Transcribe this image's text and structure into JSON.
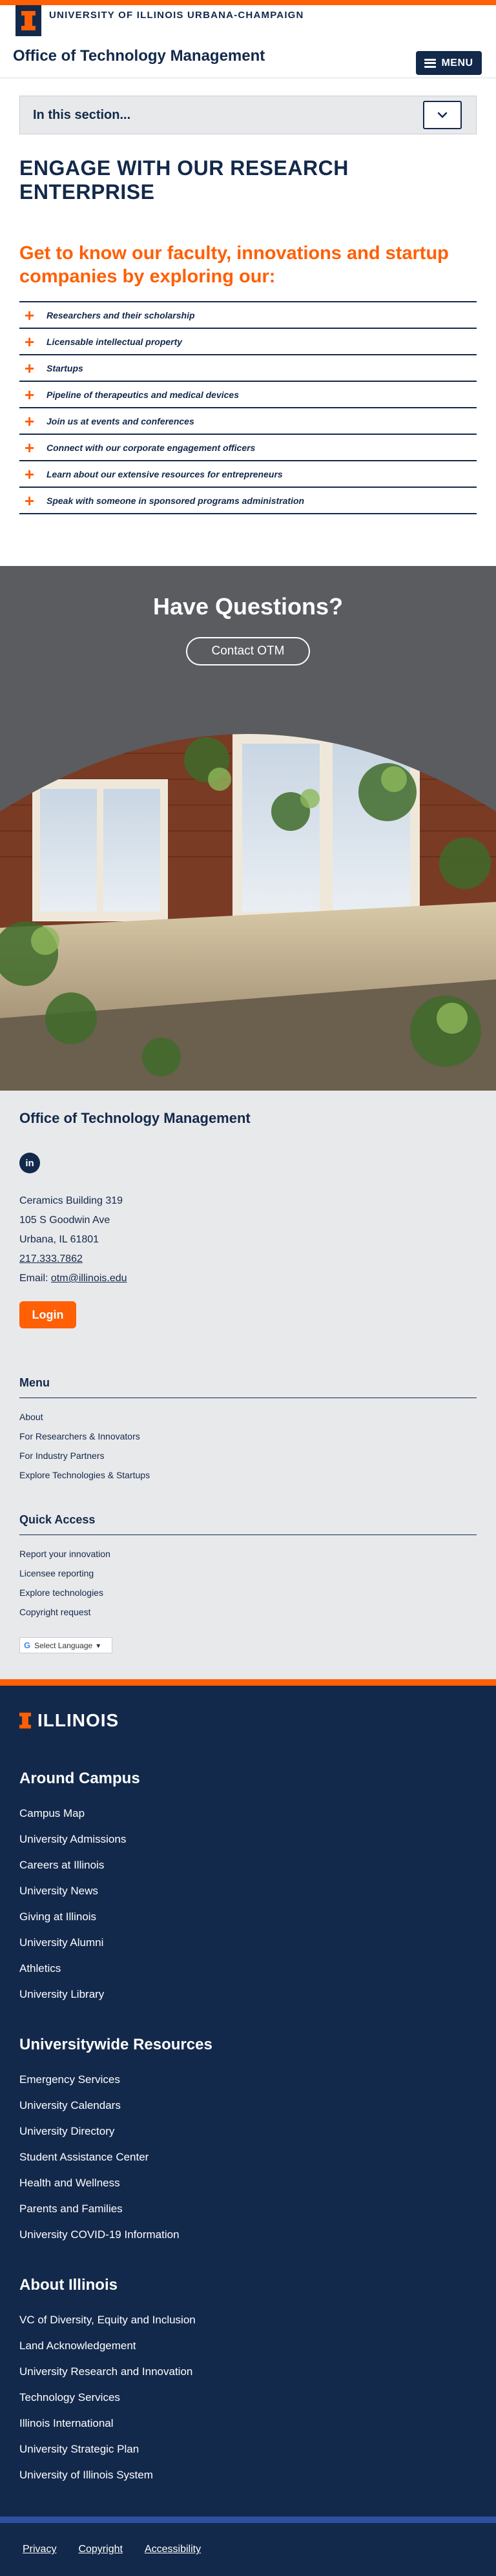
{
  "header": {
    "university": "UNIVERSITY OF ILLINOIS URBANA-CHAMPAIGN",
    "site_title": "Office of Technology Management",
    "menu_label": "MENU"
  },
  "section_nav": {
    "label": "In this section..."
  },
  "main": {
    "heading": "ENGAGE WITH OUR RESEARCH ENTERPRISE",
    "intro": "Get to know our faculty, innovations and startup companies by exploring our:",
    "items": [
      {
        "label": "Researchers and their scholarship"
      },
      {
        "label": "Licensable intellectual property"
      },
      {
        "label": "Startups"
      },
      {
        "label": "Pipeline of therapeutics and medical devices"
      },
      {
        "label": "Join us at events and conferences"
      },
      {
        "label": "Connect with our corporate engagement officers"
      },
      {
        "label": "Learn about our extensive resources for entrepreneurs"
      },
      {
        "label": "Speak with someone in sponsored programs administration"
      }
    ]
  },
  "questions": {
    "title": "Have Questions?",
    "button": "Contact OTM"
  },
  "footer": {
    "title": "Office of Technology Management",
    "social_icon": "linkedin-icon",
    "address_lines": [
      "Ceramics Building 319",
      "105 S Goodwin Ave",
      "Urbana, IL 61801"
    ],
    "phone": "217.333.7862",
    "email_label": "Email: ",
    "email": "otm@illinois.edu",
    "login": "Login",
    "menu_heading": "Menu",
    "menu_links": [
      {
        "label": "About"
      },
      {
        "label": "For Researchers & Innovators"
      },
      {
        "label": "For Industry Partners"
      },
      {
        "label": "Explore Technologies & Startups"
      }
    ],
    "quick_heading": "Quick Access",
    "quick_links": [
      {
        "label": "Report your innovation"
      },
      {
        "label": "Licensee reporting"
      },
      {
        "label": "Explore technologies"
      },
      {
        "label": "Copyright request"
      }
    ],
    "translate_label": "Select Language"
  },
  "campus": {
    "logo_text": "ILLINOIS",
    "sections": [
      {
        "heading": "Around Campus",
        "links": [
          "Campus Map",
          "University Admissions",
          "Careers at Illinois",
          "University News",
          "Giving at Illinois",
          "University Alumni",
          "Athletics",
          "University Library"
        ]
      },
      {
        "heading": "Universitywide Resources",
        "links": [
          "Emergency Services",
          "University Calendars",
          "University Directory",
          "Student Assistance Center",
          "Health and Wellness",
          "Parents and Families",
          "University COVID-19 Information"
        ]
      },
      {
        "heading": "About Illinois",
        "links": [
          "VC of Diversity, Equity and Inclusion",
          "Land Acknowledgement",
          "University Research and Innovation",
          "Technology Services",
          "Illinois International",
          "University Strategic Plan",
          "University of Illinois System"
        ]
      }
    ],
    "legal": [
      "Privacy",
      "Copyright",
      "Accessibility"
    ]
  },
  "colors": {
    "navy": "#13294b",
    "orange": "#ff5f05",
    "gray": "#e8e9eb"
  }
}
